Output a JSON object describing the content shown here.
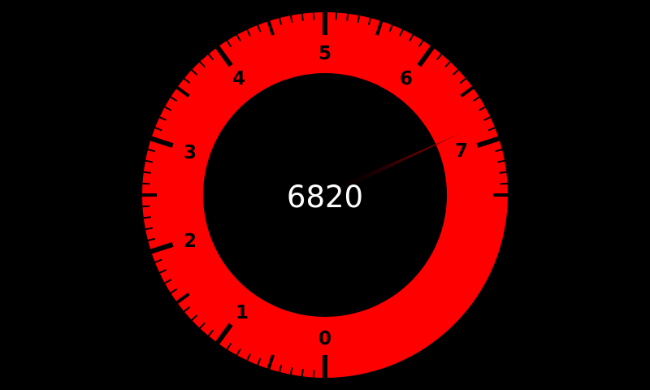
{
  "gauge": {
    "title": "",
    "unit": "",
    "readout": "6820",
    "value": 6820,
    "scale_max": 7500,
    "scale_labels": [
      "0",
      "1",
      "2",
      "3",
      "4",
      "5",
      "6",
      "7"
    ],
    "needle_icon": "tachometer-needle",
    "colors": {
      "background": "#000000",
      "ring": "#ff0000",
      "ticks": "#000000",
      "readout_text": "#ffffff"
    }
  }
}
